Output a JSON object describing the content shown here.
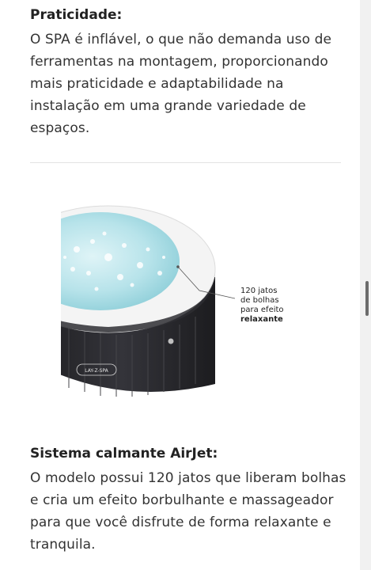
{
  "section1": {
    "title": "Praticidade:",
    "body": "O SPA é inflável, o que não demanda uso de ferramentas na montagem, proporcionando mais praticidade e adaptabilidade na instalação em uma grande variedade de espaços."
  },
  "image": {
    "brand_label": "LAY-Z-SPA",
    "annotation_line1": "120 jatos",
    "annotation_line2": "de bolhas",
    "annotation_line3": "para efeito",
    "annotation_line4": "relaxante"
  },
  "section2": {
    "title": "Sistema calmante AirJet:",
    "body": "O modelo possui 120 jatos que liberam bolhas e cria um efeito borbulhante e massageador para que você disfrute de forma relaxante e tranquila."
  },
  "colors": {
    "tub_body": "#2b2b2f",
    "tub_rim": "#f3f3f3",
    "water": "#bfe6ec",
    "divider": "#e3e3e3"
  }
}
